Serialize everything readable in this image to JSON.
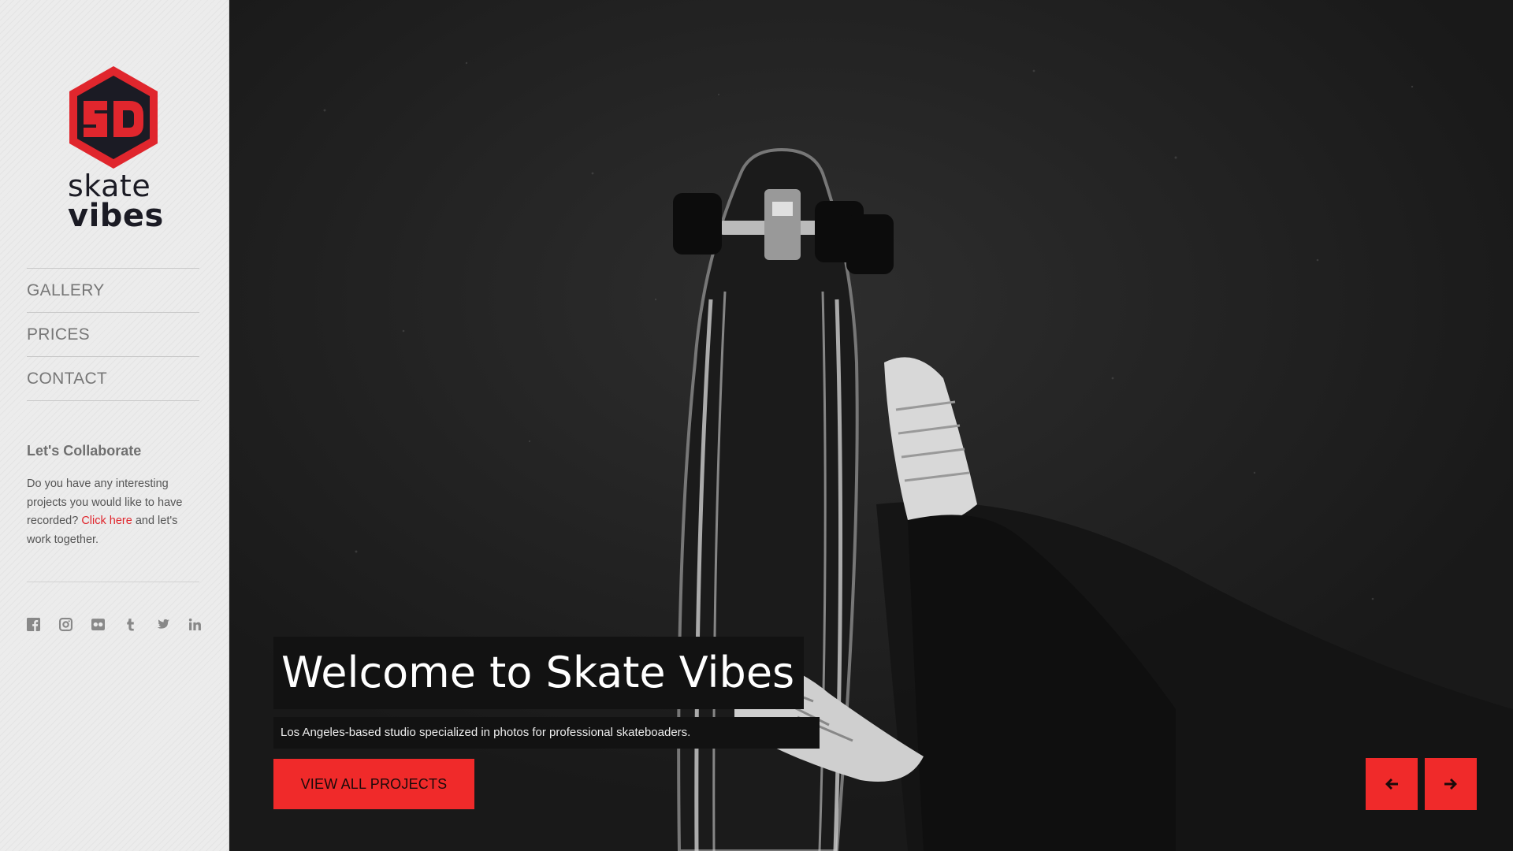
{
  "brand": {
    "logo_text_line1": "skate",
    "logo_text_line2": "vibes",
    "logo_monogram": "SD",
    "logo_colors": {
      "primary": "#e0262d",
      "dark": "#1b1b24"
    }
  },
  "nav": {
    "items": [
      {
        "label": "GALLERY"
      },
      {
        "label": "PRICES"
      },
      {
        "label": "CONTACT"
      }
    ]
  },
  "collab": {
    "title": "Let's Collaborate",
    "text_before": "Do you have any interesting projects you would like to have recorded? ",
    "link_label": "Click here",
    "text_after": " and let's work together."
  },
  "social": {
    "icons": [
      "facebook-icon",
      "instagram-icon",
      "flickr-icon",
      "tumblr-icon",
      "twitter-icon",
      "linkedin-icon"
    ]
  },
  "hero": {
    "title": "Welcome to Skate Vibes",
    "subtitle": "Los Angeles-based studio specialized in photos for professional skateboaders.",
    "cta_label": "VIEW ALL PROJECTS",
    "prev_icon": "arrow-left-icon",
    "next_icon": "arrow-right-icon"
  },
  "colors": {
    "accent": "#f02a2a",
    "link": "#e0262d",
    "sidebar_bg": "#ececec",
    "hero_bg": "#1d1d1d"
  }
}
